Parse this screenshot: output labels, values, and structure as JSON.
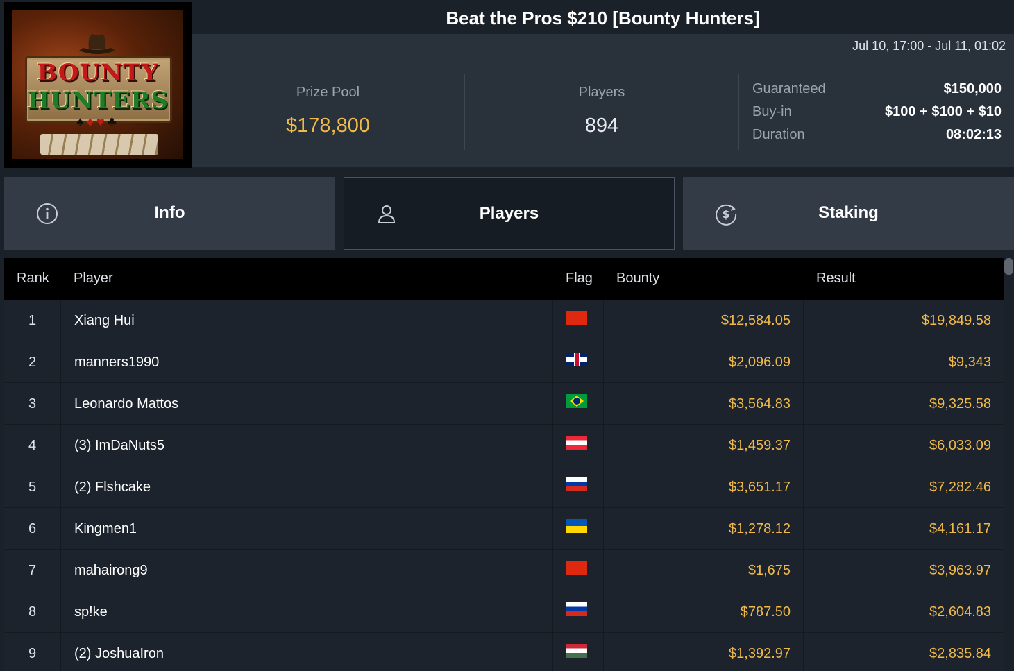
{
  "logo": {
    "line1": "BOUNTY",
    "line2": "HUNTERS",
    "suits": "♠♦♥♣"
  },
  "tournament": {
    "title": "Beat the Pros $210 [Bounty Hunters]",
    "dates": "Jul 10, 17:00 - Jul 11, 01:02"
  },
  "stats": {
    "prize_pool_label": "Prize Pool",
    "prize_pool_value": "$178,800",
    "players_label": "Players",
    "players_value": "894",
    "details": [
      {
        "key": "Guaranteed",
        "value": "$150,000"
      },
      {
        "key": "Buy-in",
        "value": "$100 + $100 + $10"
      },
      {
        "key": "Duration",
        "value": "08:02:13"
      }
    ]
  },
  "tabs": [
    {
      "label": "Info",
      "icon": "info-icon",
      "active": false
    },
    {
      "label": "Players",
      "icon": "user-icon",
      "active": true
    },
    {
      "label": "Staking",
      "icon": "dollar-coin-icon",
      "active": false
    }
  ],
  "table": {
    "columns": [
      "Rank",
      "Player",
      "Flag",
      "Bounty",
      "Result"
    ],
    "rows": [
      {
        "rank": "1",
        "player": "Xiang Hui",
        "flag": "cn",
        "bounty": "$12,584.05",
        "result": "$19,849.58"
      },
      {
        "rank": "2",
        "player": "manners1990",
        "flag": "gb",
        "bounty": "$2,096.09",
        "result": "$9,343"
      },
      {
        "rank": "3",
        "player": "Leonardo Mattos",
        "flag": "br",
        "bounty": "$3,564.83",
        "result": "$9,325.58"
      },
      {
        "rank": "4",
        "player": "(3) ImDaNuts5",
        "flag": "at",
        "bounty": "$1,459.37",
        "result": "$6,033.09"
      },
      {
        "rank": "5",
        "player": "(2) Flshcake",
        "flag": "ru",
        "bounty": "$3,651.17",
        "result": "$7,282.46"
      },
      {
        "rank": "6",
        "player": "Kingmen1",
        "flag": "ua",
        "bounty": "$1,278.12",
        "result": "$4,161.17"
      },
      {
        "rank": "7",
        "player": "mahairong9",
        "flag": "cn",
        "bounty": "$1,675",
        "result": "$3,963.97"
      },
      {
        "rank": "8",
        "player": "sp!ke",
        "flag": "ru",
        "bounty": "$787.50",
        "result": "$2,604.83"
      },
      {
        "rank": "9",
        "player": "(2) JoshuaIron",
        "flag": "hu",
        "bounty": "$1,392.97",
        "result": "$2,835.84"
      }
    ]
  },
  "colors": {
    "gold": "#f0b94a",
    "panel": "#29313b",
    "background": "#1b2129"
  }
}
